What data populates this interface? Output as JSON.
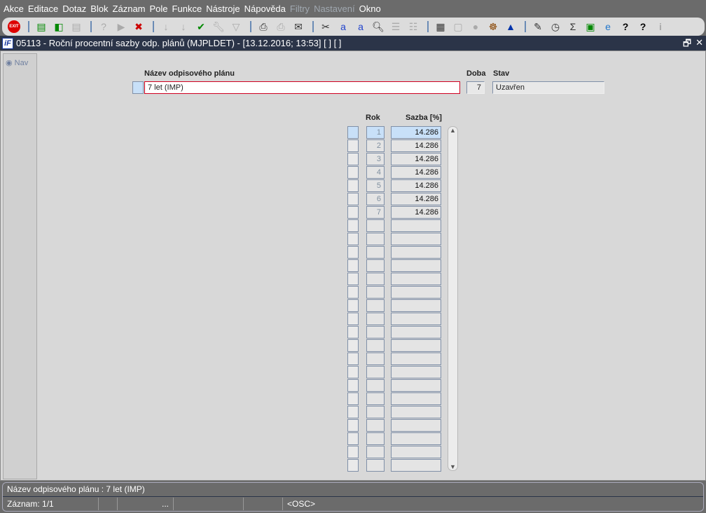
{
  "menu": [
    {
      "label": "Akce"
    },
    {
      "label": "Editace"
    },
    {
      "label": "Dotaz"
    },
    {
      "label": "Blok"
    },
    {
      "label": "Záznam"
    },
    {
      "label": "Pole"
    },
    {
      "label": "Funkce"
    },
    {
      "label": "Nástroje"
    },
    {
      "label": "Nápověda"
    },
    {
      "label": "Filtry",
      "disabled": true
    },
    {
      "label": "Nastavení",
      "disabled": true
    },
    {
      "label": "Okno"
    }
  ],
  "toolbar": {
    "exit_label": "EXIT"
  },
  "window": {
    "title": "05113 - Roční procentní sazby odp. plánů (MJPLDET) - [13.12.2016; 13:53]  [ ] [ ]",
    "logo": "iF"
  },
  "nav": {
    "label": "Nav"
  },
  "form": {
    "name_label": "Název odpisového plánu",
    "name_value": "7 let (IMP)",
    "doba_label": "Doba",
    "doba_value": "7",
    "stav_label": "Stav",
    "stav_value": "Uzavřen"
  },
  "grid": {
    "rok_header": "Rok",
    "sazba_header": "Sazba [%]",
    "rows": [
      {
        "rok": "1",
        "sazba": "14.286"
      },
      {
        "rok": "2",
        "sazba": "14.286"
      },
      {
        "rok": "3",
        "sazba": "14.286"
      },
      {
        "rok": "4",
        "sazba": "14.286"
      },
      {
        "rok": "5",
        "sazba": "14.286"
      },
      {
        "rok": "6",
        "sazba": "14.286"
      },
      {
        "rok": "7",
        "sazba": "14.286"
      }
    ],
    "total_rows": 26
  },
  "status": {
    "line1": "Název odpisového plánu :  7 let (IMP)",
    "record": "Záznam: 1/1",
    "dots": "...",
    "mode": "<OSC>"
  }
}
